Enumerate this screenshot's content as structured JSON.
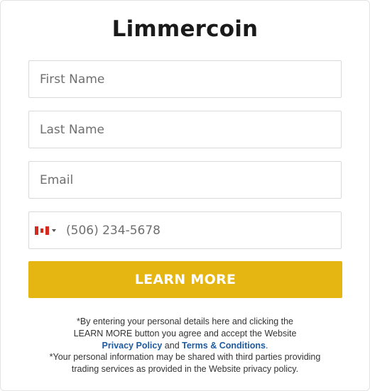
{
  "form": {
    "title": "Limmercoin",
    "first_name_placeholder": "First Name",
    "last_name_placeholder": "Last Name",
    "email_placeholder": "Email",
    "phone_placeholder": "(506) 234-5678",
    "country_flag": "canada-flag-icon",
    "submit_label": "LEARN MORE",
    "accent_color": "#e5b512"
  },
  "disclaimer": {
    "line1": "*By entering your personal details here and clicking the",
    "line2": "LEARN MORE button you agree and accept the Website",
    "privacy_link": "Privacy Policy",
    "and": "and",
    "terms_link": "Terms & Conditions",
    "period": ".",
    "line4": "*Your personal information may be shared with third parties providing",
    "line5": "trading services as provided in the Website privacy policy."
  }
}
